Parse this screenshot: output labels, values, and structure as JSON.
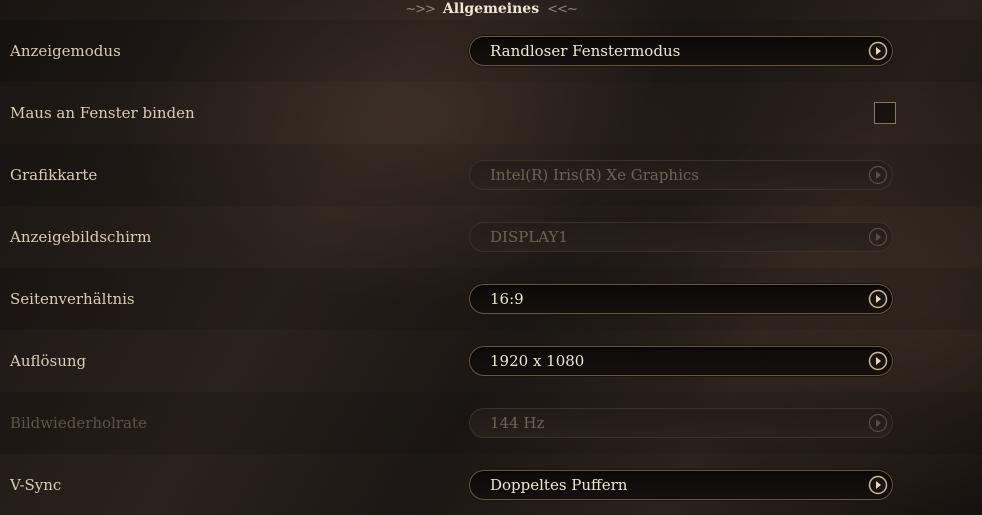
{
  "section": {
    "title": "Allgemeines",
    "left_flourish_icon": "ornament-left-icon",
    "right_flourish_icon": "ornament-right-icon"
  },
  "colors": {
    "label": "#d9ccb6",
    "label_disabled": "#5f5347",
    "dropdown_border": "#6b5641",
    "arrow_accent": "#c8b79b"
  },
  "settings": {
    "anzeigemodus": {
      "label": "Anzeigemodus",
      "value": "Randloser Fenstermodus",
      "enabled": true
    },
    "maus": {
      "label": "Maus an Fenster binden",
      "checked": false,
      "enabled": true
    },
    "grafikkarte": {
      "label": "Grafikkarte",
      "value": "Intel(R) Iris(R) Xe Graphics",
      "enabled": false
    },
    "anzeigebildschirm": {
      "label": "Anzeigebildschirm",
      "value": "DISPLAY1",
      "enabled": false
    },
    "seitenverhaeltnis": {
      "label": "Seitenverhältnis",
      "value": "16:9",
      "enabled": true
    },
    "aufloesung": {
      "label": "Auflösung",
      "value": "1920 x 1080",
      "enabled": true
    },
    "bildwiederholrate": {
      "label": "Bildwiederholrate",
      "value": "144 Hz",
      "enabled": false
    },
    "vsync": {
      "label": "V-Sync",
      "value": "Doppeltes Puffern",
      "enabled": true
    }
  }
}
